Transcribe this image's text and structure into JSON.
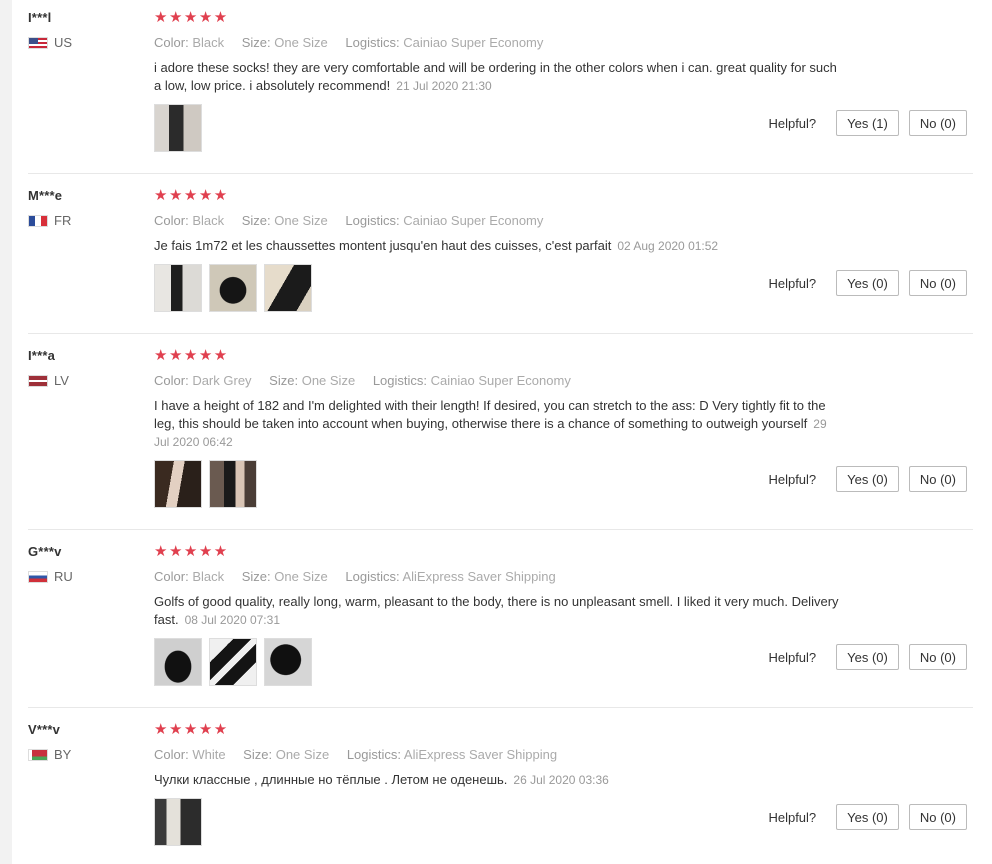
{
  "labels": {
    "color": "Color:",
    "size": "Size:",
    "logistics": "Logistics:",
    "helpful": "Helpful?"
  },
  "reviews": [
    {
      "user": "I***l",
      "country": "US",
      "stars": "★★★★★",
      "color": "Black",
      "size": "One Size",
      "logistics": "Cainiao Super Economy",
      "text": "i adore these socks! they are very comfortable and will be ordering in the other colors when i can. great quality for such a low, low price. i absolutely recommend!",
      "date": "21 Jul 2020 21:30",
      "yes": "Yes (1)",
      "no": "No (0)"
    },
    {
      "user": "M***e",
      "country": "FR",
      "stars": "★★★★★",
      "color": "Black",
      "size": "One Size",
      "logistics": "Cainiao Super Economy",
      "text": "Je fais 1m72 et les chaussettes montent jusqu'en haut des cuisses, c'est parfait",
      "date": "02 Aug 2020 01:52",
      "yes": "Yes (0)",
      "no": "No (0)"
    },
    {
      "user": "I***a",
      "country": "LV",
      "stars": "★★★★★",
      "color": "Dark Grey",
      "size": "One Size",
      "logistics": "Cainiao Super Economy",
      "text": "I have a height of 182 and I'm delighted with their length! If desired, you can stretch to the ass: D Very tightly fit to the leg, this should be taken into account when buying, otherwise there is a chance of something to outweigh yourself",
      "date": "29 Jul 2020 06:42",
      "yes": "Yes (0)",
      "no": "No (0)"
    },
    {
      "user": "G***v",
      "country": "RU",
      "stars": "★★★★★",
      "color": "Black",
      "size": "One Size",
      "logistics": "AliExpress Saver Shipping",
      "text": "Golfs of good quality, really long, warm, pleasant to the body, there is no unpleasant smell. I liked it very much. Delivery fast.",
      "date": "08 Jul 2020 07:31",
      "yes": "Yes (0)",
      "no": "No (0)"
    },
    {
      "user": "V***v",
      "country": "BY",
      "stars": "★★★★★",
      "color": "White",
      "size": "One Size",
      "logistics": "AliExpress Saver Shipping",
      "text": "Чулки классные , длинные но тёплые . Летом не оденешь.",
      "date": "26 Jul 2020 03:36",
      "yes": "Yes (0)",
      "no": "No (0)"
    }
  ]
}
